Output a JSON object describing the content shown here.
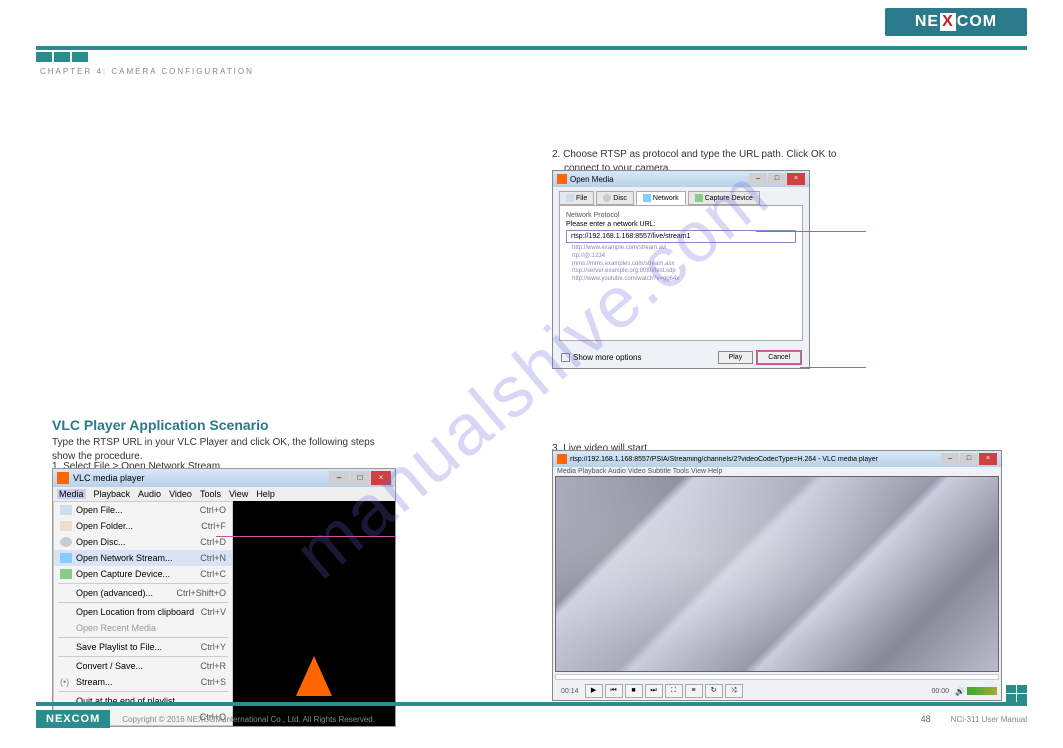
{
  "header": {
    "brand": "NEXCOM",
    "chapter": "CHAPTER 4: CAMERA CONFIGURATION"
  },
  "sections": {
    "title_left": "VLC Player Application Scenario",
    "para_left": "Type the RTSP URL in your VLC Player and click OK, the following steps show the procedure.",
    "step1": "1. Select File > Open Network Stream.",
    "step2_line1": "2. Choose RTSP as protocol and type the URL path. Click OK to",
    "step2_line2": "connect to your camera.",
    "step3": "3. Live video will start."
  },
  "vlc_menu": {
    "title": "VLC media player",
    "menus": [
      "Media",
      "Playback",
      "Audio",
      "Video",
      "Tools",
      "View",
      "Help"
    ],
    "items": [
      {
        "label": "Open File...",
        "shortcut": "Ctrl+O"
      },
      {
        "label": "Open Folder...",
        "shortcut": "Ctrl+F"
      },
      {
        "label": "Open Disc...",
        "shortcut": "Ctrl+D"
      },
      {
        "label": "Open Network Stream...",
        "shortcut": "Ctrl+N",
        "selected": true
      },
      {
        "label": "Open Capture Device...",
        "shortcut": "Ctrl+C"
      },
      {
        "label": "Open (advanced)...",
        "shortcut": "Ctrl+Shift+O"
      },
      {
        "label": "Open Location from clipboard",
        "shortcut": "Ctrl+V"
      },
      {
        "label": "Open Recent Media",
        "shortcut": ""
      },
      {
        "label": "Save Playlist to File...",
        "shortcut": "Ctrl+Y"
      },
      {
        "label": "Convert / Save...",
        "shortcut": "Ctrl+R"
      },
      {
        "label": "Stream...",
        "shortcut": "Ctrl+S"
      },
      {
        "label": "Quit at the end of playlist",
        "shortcut": ""
      },
      {
        "label": "Quit",
        "shortcut": "Ctrl+Q"
      }
    ]
  },
  "open_media": {
    "title": "Open Media",
    "tabs": [
      "File",
      "Disc",
      "Network",
      "Capture Device"
    ],
    "panel_title": "Network Protocol",
    "prompt": "Please enter a network URL:",
    "url": "rtsp://192.168.1.168:8557/live/stream1",
    "examples": [
      "http://www.example.com/stream.avi",
      "rtp://@:1234",
      "mms://mms.examples.com/stream.asx",
      "rtsp://server.example.org:8080/test.sdp",
      "http://www.youtube.com/watch?v=gg64x"
    ],
    "more_options": "Show more options",
    "play": "Play",
    "cancel": "Cancel"
  },
  "video_window": {
    "title": "rtsp://192.168.1.168:8557/PSIA/Streaming/channels/2?videoCodecType=H.264 - VLC media player",
    "menus": "Media   Playback   Audio   Video   Subtitle   Tools   View   Help",
    "time_left": "00:14",
    "time_right": "00:00"
  },
  "footer": {
    "brand": "NEXCOM",
    "copy": "Copyright © 2016 NEXCOM International Co., Ltd. All Rights Reserved.",
    "page": "48",
    "manual": "NCi-311 User Manual"
  },
  "watermark": "manualshive.com"
}
